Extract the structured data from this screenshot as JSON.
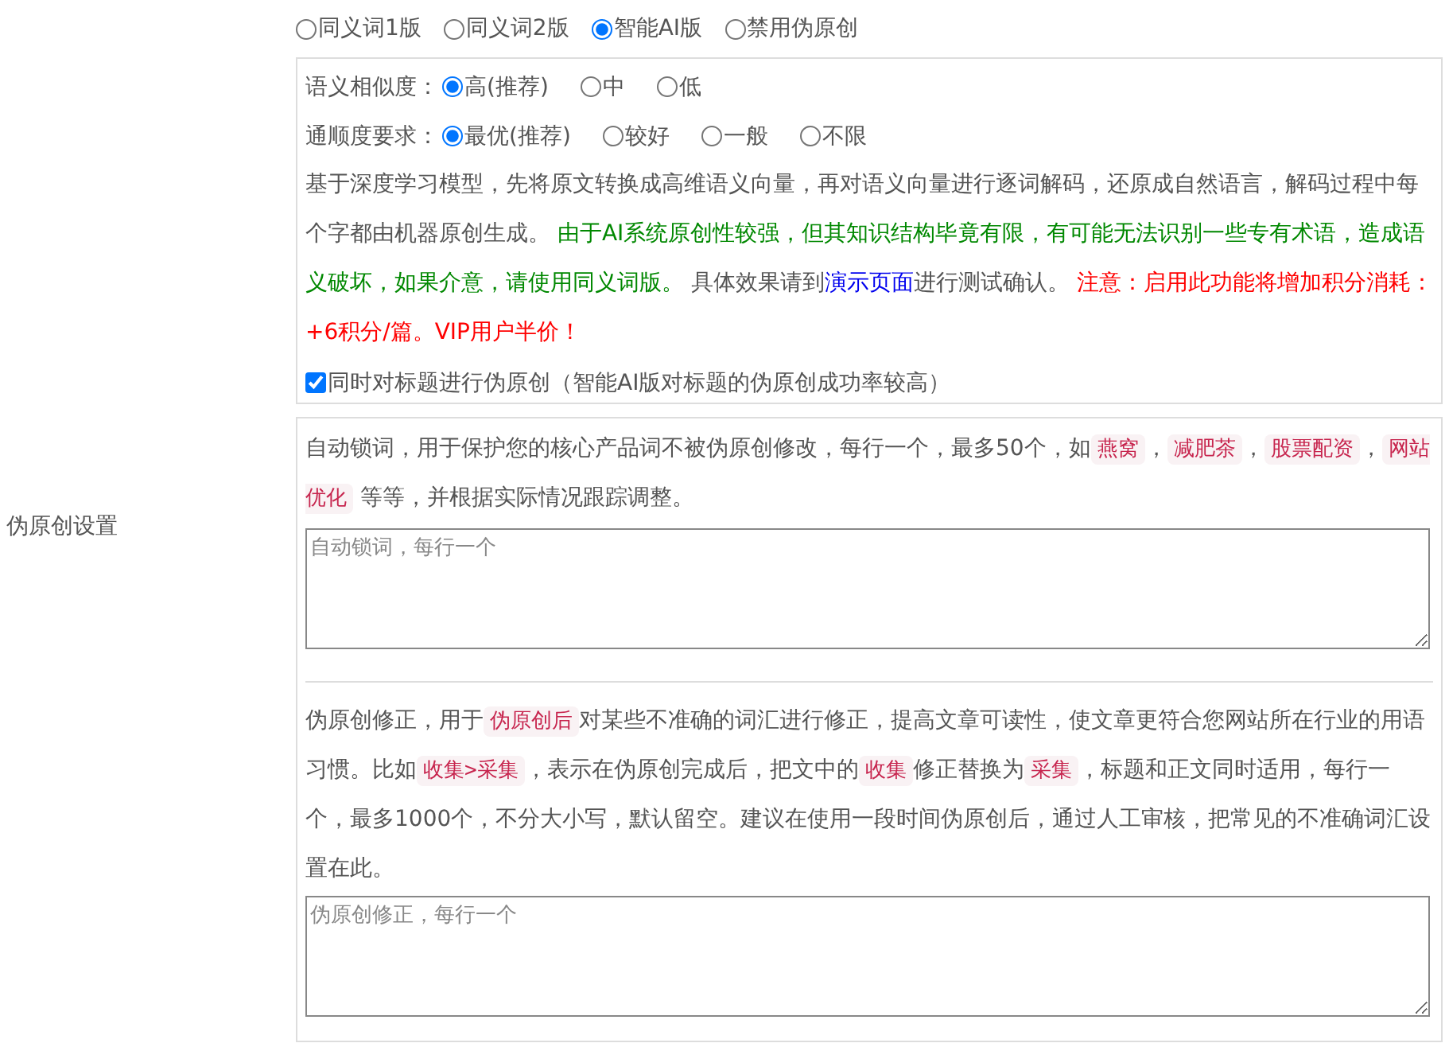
{
  "section_label": "伪原创设置",
  "modes": [
    {
      "label": "同义词1版",
      "selected": false
    },
    {
      "label": "同义词2版",
      "selected": false
    },
    {
      "label": "智能AI版",
      "selected": true
    },
    {
      "label": "禁用伪原创",
      "selected": false
    }
  ],
  "ai_settings": {
    "options": [
      {
        "label": "语义相似度：",
        "choices": [
          {
            "label": "高(推荐)",
            "selected": true
          },
          {
            "label": "中",
            "selected": false
          },
          {
            "label": "低",
            "selected": false
          }
        ]
      },
      {
        "label": "通顺度要求：",
        "choices": [
          {
            "label": "最优(推荐)",
            "selected": true
          },
          {
            "label": "较好",
            "selected": false
          },
          {
            "label": "一般",
            "selected": false
          },
          {
            "label": "不限",
            "selected": false
          }
        ]
      }
    ],
    "description": [
      {
        "kind": "text",
        "text": "基于深度学习模型，先将原文转换成高维语义向量，再对语义向量进行逐词解码，还原成自然语言，解码过程中每个字都由机器原创生成。 "
      },
      {
        "kind": "green",
        "text": "由于AI系统原创性较强，但其知识结构毕竟有限，有可能无法识别一些专有术语，造成语义破坏，如果介意，请使用同义词版。"
      },
      {
        "kind": "text",
        "text": " 具体效果请到"
      },
      {
        "kind": "link",
        "text": "演示页面"
      },
      {
        "kind": "text",
        "text": "进行测试确认。 "
      },
      {
        "kind": "red",
        "text": "注意：启用此功能将增加积分消耗：+6积分/篇。VIP用户半价！"
      }
    ],
    "title_option": {
      "label": "同时对标题进行伪原创（智能AI版对标题的伪原创成功率较高）",
      "checked": true
    }
  },
  "lock_words": {
    "description": [
      {
        "kind": "text",
        "text": "自动锁词，用于保护您的核心产品词不被伪原创修改，每行一个，最多50个，如"
      },
      {
        "kind": "tag",
        "text": "燕窝"
      },
      {
        "kind": "text",
        "text": "，"
      },
      {
        "kind": "tag",
        "text": "减肥茶"
      },
      {
        "kind": "text",
        "text": "，"
      },
      {
        "kind": "tag",
        "text": "股票配资"
      },
      {
        "kind": "text",
        "text": "，"
      },
      {
        "kind": "tag",
        "text": "网站优化"
      },
      {
        "kind": "text",
        "text": " 等等，并根据实际情况跟踪调整。"
      }
    ],
    "placeholder": "自动锁词，每行一个"
  },
  "corrections": {
    "description": [
      {
        "kind": "text",
        "text": "伪原创修正，用于"
      },
      {
        "kind": "tag",
        "text": "伪原创后"
      },
      {
        "kind": "text",
        "text": "对某些不准确的词汇进行修正，提高文章可读性，使文章更符合您网站所在行业的用语习惯。比如"
      },
      {
        "kind": "tag",
        "text": "收集>采集"
      },
      {
        "kind": "text",
        "text": "，表示在伪原创完成后，把文中的"
      },
      {
        "kind": "tag",
        "text": "收集"
      },
      {
        "kind": "text",
        "text": "修正替换为"
      },
      {
        "kind": "tag",
        "text": "采集"
      },
      {
        "kind": "text",
        "text": "，标题和正文同时适用，每行一个，最多1000个，不分大小写，默认留空。建议在使用一段时间伪原创后，通过人工审核，把常见的不准确词汇设置在此。"
      }
    ],
    "placeholder": "伪原创修正，每行一个"
  }
}
